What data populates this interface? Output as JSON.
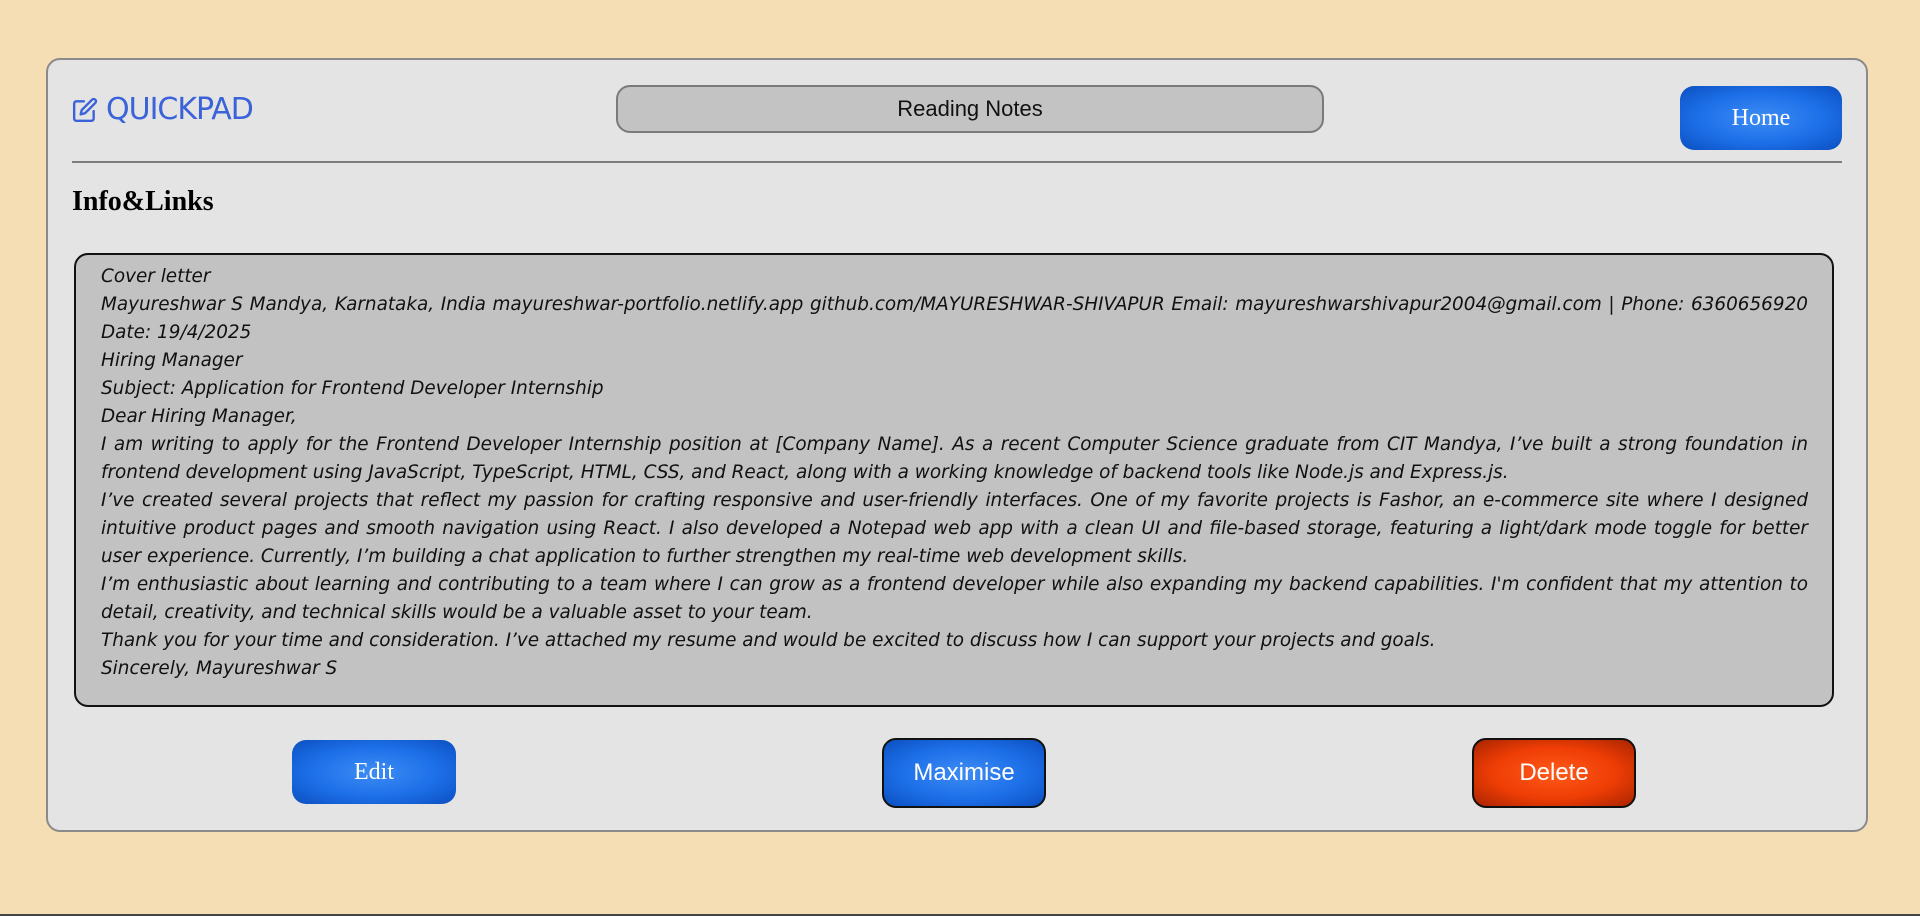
{
  "app": {
    "logo_text": "QUICKPAD",
    "logo_icon": "edit-icon",
    "brand_color": "#3b63d9",
    "background_color": "#f5deb3"
  },
  "header": {
    "note_title": "Reading Notes",
    "home_label": "Home"
  },
  "section": {
    "heading": "Info&Links"
  },
  "note": {
    "lines": [
      "Cover letter",
      "Mayureshwar S Mandya, Karnataka, India mayureshwar-portfolio.netlify.app github.com/MAYURESHWAR-SHIVAPUR Email: mayureshwarshivapur2004@gmail.com | Phone: 6360656920 Date: 19/4/2025",
      "Hiring Manager",
      "Subject: Application for Frontend Developer Internship",
      "Dear Hiring Manager,",
      "I am writing to apply for the Frontend Developer Internship position at [Company Name]. As a recent Computer Science graduate from CIT Mandya, I’ve built a strong foundation in frontend development using JavaScript, TypeScript, HTML, CSS, and React, along with a working knowledge of backend tools like Node.js and Express.js.",
      "I’ve created several projects that reflect my passion for crafting responsive and user-friendly interfaces. One of my favorite projects is Fashor, an e-commerce site where I designed intuitive product pages and smooth navigation using React. I also developed a Notepad web app with a clean UI and file-based storage, featuring a light/dark mode toggle for better user experience. Currently, I’m building a chat application to further strengthen my real-time web development skills.",
      "I’m enthusiastic about learning and contributing to a team where I can grow as a frontend developer while also expanding my backend capabilities. I'm confident that my attention to detail, creativity, and technical skills would be a valuable asset to your team.",
      "Thank you for your time and consideration. I’ve attached my resume and would be excited to discuss how I can support your projects and goals.",
      "Sincerely, Mayureshwar S"
    ]
  },
  "actions": {
    "edit_label": "Edit",
    "maximise_label": "Maximise",
    "delete_label": "Delete",
    "primary_color": "#1d6fe8",
    "danger_color": "#ee3d05"
  }
}
